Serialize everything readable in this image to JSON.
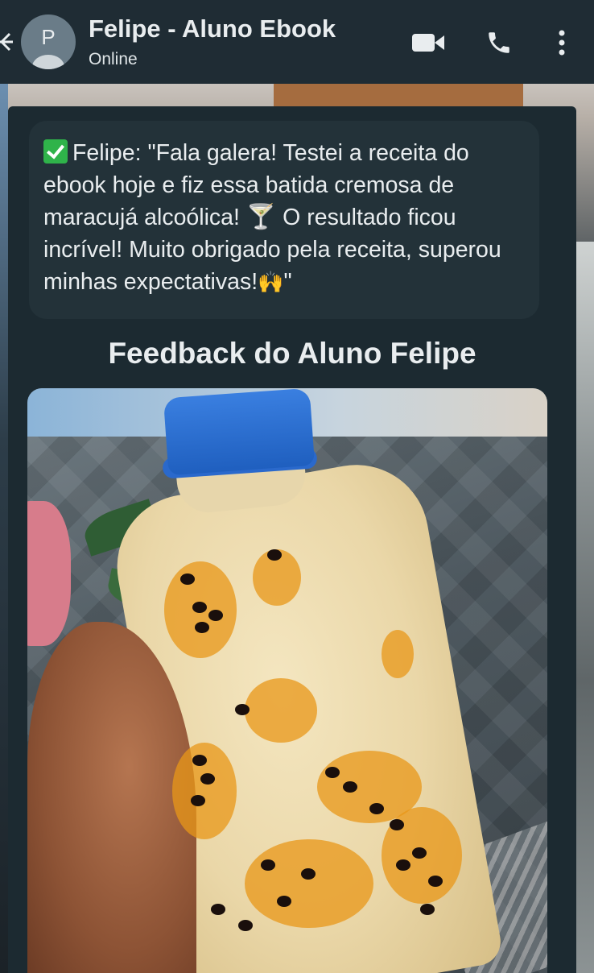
{
  "header": {
    "back_icon": "back-arrow-icon",
    "avatar_letter": "P",
    "title": "Felipe - Aluno Ebook",
    "status": "Online",
    "actions": [
      "video-call-icon",
      "phone-icon",
      "more-vert-icon"
    ]
  },
  "message": {
    "check_icon": "check-mark-button-emoji",
    "text_part1": "Felipe: \"Fala galera! Testei a receita do ebook hoje e fiz essa batida cremosa de maracujá alcoólica! ",
    "cocktail_icon": "cocktail-glass-emoji",
    "text_part2": " O resultado ficou incrível! Muito obrigado pela receita, superou minhas expectativas!",
    "hands_icon": "raising-hands-emoji",
    "text_end": "\""
  },
  "section_title": "Feedback do Aluno Felipe",
  "photo": {
    "subject": "hand-holding-passion-fruit-drink-bottle"
  },
  "colors": {
    "header_bg": "#1f2c34",
    "card_bg": "#1c2a31",
    "bubble_bg": "#233239",
    "text": "#e9edef",
    "check_green": "#2fb34a",
    "cap_blue": "#2a69cc"
  }
}
